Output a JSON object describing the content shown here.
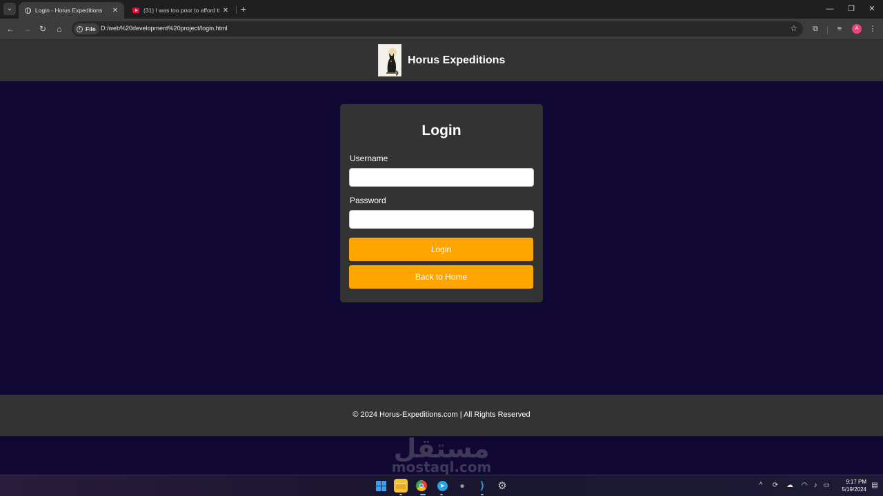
{
  "browser": {
    "tabs": [
      {
        "title": "Login - Horus Expeditions",
        "favicon": "globe-icon",
        "active": true
      },
      {
        "title": "(31) I was too poor to afford th",
        "favicon": "youtube-icon",
        "active": false
      }
    ],
    "address": {
      "scheme_chip": "File",
      "url": "D:/web%20development%20project/login.html"
    }
  },
  "site": {
    "brand_name": "Horus Expeditions"
  },
  "login": {
    "title": "Login",
    "username_label": "Username",
    "username_value": "",
    "password_label": "Password",
    "password_value": "",
    "login_button": "Login",
    "back_button": "Back to Home"
  },
  "footer": {
    "text": "© 2024 Horus-Expeditions.com | All Rights Reserved"
  },
  "watermark": {
    "arabic": "مستقل",
    "latin": "mostaql.com"
  },
  "taskbar": {
    "time": "9:17 PM",
    "date": "5/19/2024"
  },
  "colors": {
    "page_background": "#110733",
    "header_footer": "#333333",
    "button": "#ffa500"
  }
}
